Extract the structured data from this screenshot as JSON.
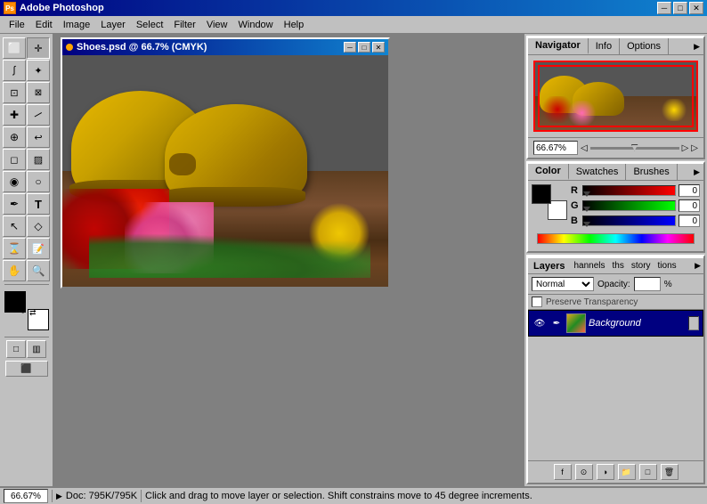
{
  "app": {
    "title": "Adobe Photoshop",
    "icon": "PS"
  },
  "titlebar": {
    "minimize": "─",
    "maximize": "□",
    "close": "✕"
  },
  "menubar": {
    "items": [
      "File",
      "Edit",
      "Image",
      "Layer",
      "Select",
      "Filter",
      "View",
      "Window",
      "Help"
    ]
  },
  "document": {
    "title": "Shoes.psd @ 66.7% (CMYK)",
    "modified": true
  },
  "navigator": {
    "tabs": [
      "Navigator",
      "Info",
      "Options"
    ],
    "zoom_value": "66.67%"
  },
  "color_panel": {
    "tabs": [
      "Color",
      "Swatches",
      "Brushes"
    ],
    "channels": {
      "r_label": "R",
      "g_label": "G",
      "b_label": "B",
      "r_value": "0",
      "g_value": "0",
      "b_value": "0"
    }
  },
  "layers_panel": {
    "active_tab": "Layers",
    "tabs": [
      "Layers",
      "Channels",
      "Paths",
      "History",
      "Actions"
    ],
    "blend_mode": "Normal",
    "opacity_label": "Opacity:",
    "opacity_value": "",
    "opacity_pct": "%",
    "preserve_label": "Preserve Transparency",
    "layers": [
      {
        "name": "Background",
        "visible": true,
        "active": true
      }
    ]
  },
  "statusbar": {
    "zoom": "66.67%",
    "doc_label": "Doc: 795K/795K",
    "message": "Click and drag to move layer or selection. Shift constrains move to 45 degree increments."
  },
  "toolbar": {
    "tools": [
      {
        "name": "marquee",
        "icon": "⊡"
      },
      {
        "name": "move",
        "icon": "✛"
      },
      {
        "name": "lasso",
        "icon": "⌀"
      },
      {
        "name": "magic-wand",
        "icon": "✦"
      },
      {
        "name": "crop",
        "icon": "⊞"
      },
      {
        "name": "slice",
        "icon": "⊠"
      },
      {
        "name": "healing",
        "icon": "✚"
      },
      {
        "name": "brush",
        "icon": "∥"
      },
      {
        "name": "stamp",
        "icon": "⊕"
      },
      {
        "name": "eraser",
        "icon": "◻"
      },
      {
        "name": "gradient",
        "icon": "▨"
      },
      {
        "name": "blur",
        "icon": "◉"
      },
      {
        "name": "dodge",
        "icon": "○"
      },
      {
        "name": "pen",
        "icon": "⌇"
      },
      {
        "name": "type",
        "icon": "T"
      },
      {
        "name": "path-select",
        "icon": "↖"
      },
      {
        "name": "shape",
        "icon": "◇"
      },
      {
        "name": "eyedropper",
        "icon": "⌛"
      },
      {
        "name": "hand",
        "icon": "✋"
      },
      {
        "name": "zoom",
        "icon": "⌕"
      }
    ]
  }
}
